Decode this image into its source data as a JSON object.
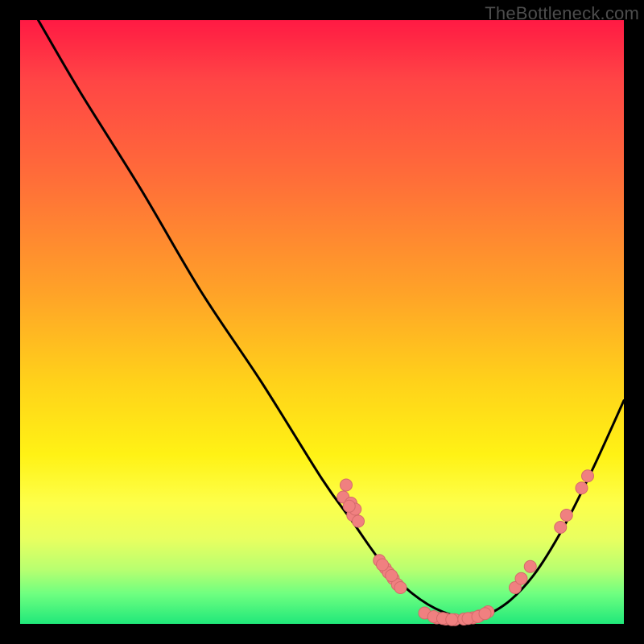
{
  "watermark": "TheBottleneck.com",
  "chart_data": {
    "type": "line",
    "title": "",
    "xlabel": "",
    "ylabel": "",
    "xlim": [
      0,
      1
    ],
    "ylim": [
      0,
      1
    ],
    "curve": {
      "x": [
        0.03,
        0.1,
        0.2,
        0.3,
        0.4,
        0.5,
        0.55,
        0.6,
        0.65,
        0.7,
        0.75,
        0.8,
        0.85,
        0.9,
        0.95,
        1.0
      ],
      "y": [
        1.0,
        0.88,
        0.72,
        0.55,
        0.4,
        0.24,
        0.17,
        0.1,
        0.05,
        0.02,
        0.01,
        0.03,
        0.08,
        0.16,
        0.26,
        0.37
      ]
    },
    "series": [
      {
        "name": "cluster-left",
        "x": [
          0.535,
          0.548,
          0.551,
          0.54,
          0.555,
          0.56,
          0.545
        ],
        "y": [
          0.21,
          0.2,
          0.18,
          0.23,
          0.19,
          0.17,
          0.195
        ]
      },
      {
        "name": "cluster-mid-falling",
        "x": [
          0.595,
          0.605,
          0.61,
          0.618,
          0.625,
          0.6,
          0.615,
          0.63
        ],
        "y": [
          0.105,
          0.092,
          0.085,
          0.075,
          0.065,
          0.098,
          0.08,
          0.06
        ]
      },
      {
        "name": "cluster-trough",
        "x": [
          0.67,
          0.69,
          0.705,
          0.72,
          0.735,
          0.75,
          0.76,
          0.775,
          0.685,
          0.7,
          0.715,
          0.742,
          0.758,
          0.77
        ],
        "y": [
          0.018,
          0.01,
          0.008,
          0.007,
          0.008,
          0.01,
          0.013,
          0.02,
          0.012,
          0.009,
          0.007,
          0.009,
          0.012,
          0.017
        ]
      },
      {
        "name": "cluster-rising",
        "x": [
          0.82,
          0.83,
          0.845
        ],
        "y": [
          0.06,
          0.075,
          0.095
        ]
      },
      {
        "name": "cluster-right-upper",
        "x": [
          0.895,
          0.905,
          0.93,
          0.94
        ],
        "y": [
          0.16,
          0.18,
          0.225,
          0.245
        ]
      }
    ],
    "colors": {
      "curve": "#000000",
      "points_fill": "#f08080",
      "points_stroke": "#d46a6a"
    }
  }
}
